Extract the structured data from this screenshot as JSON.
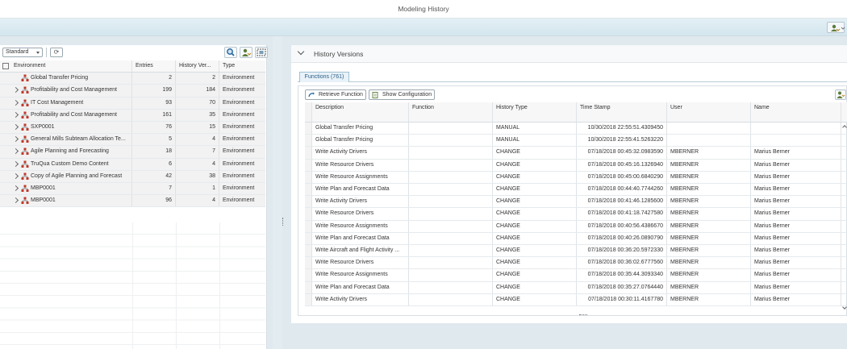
{
  "window": {
    "title": "Modeling History"
  },
  "left_panel": {
    "variant": "Standard",
    "columns": {
      "environment": "Environment",
      "entries": "Entries",
      "history_versions": "History Ver...",
      "type": "Type"
    },
    "rows": [
      {
        "environment": "Global Transfer Pricing",
        "entries": "2",
        "history_versions": "2",
        "type": "Environment",
        "expandable": false
      },
      {
        "environment": "Profitability and Cost Management",
        "entries": "199",
        "history_versions": "184",
        "type": "Environment",
        "expandable": true
      },
      {
        "environment": "IT Cost Management",
        "entries": "93",
        "history_versions": "70",
        "type": "Environment",
        "expandable": true
      },
      {
        "environment": "Profitability and Cost Management",
        "entries": "161",
        "history_versions": "35",
        "type": "Environment",
        "expandable": true
      },
      {
        "environment": "SXP0001",
        "entries": "76",
        "history_versions": "15",
        "type": "Environment",
        "expandable": true
      },
      {
        "environment": "General Mills Subteam Allocation Te...",
        "entries": "5",
        "history_versions": "4",
        "type": "Environment",
        "expandable": true
      },
      {
        "environment": "Agile Planning and Forecasting",
        "entries": "18",
        "history_versions": "7",
        "type": "Environment",
        "expandable": true
      },
      {
        "environment": "TruQua Custom Demo Content",
        "entries": "6",
        "history_versions": "4",
        "type": "Environment",
        "expandable": true
      },
      {
        "environment": "Copy of Agile Planning and Forecast",
        "entries": "42",
        "history_versions": "38",
        "type": "Environment",
        "expandable": true
      },
      {
        "environment": "MBP0001",
        "entries": "7",
        "history_versions": "1",
        "type": "Environment",
        "expandable": true
      },
      {
        "environment": "MBP0001",
        "entries": "96",
        "history_versions": "4",
        "type": "Environment",
        "expandable": true
      }
    ]
  },
  "right_panel": {
    "section_title": "History Versions",
    "tab_label": "Functions (761)",
    "toolbar": {
      "retrieve_label": "Retrieve Function",
      "show_config_label": "Show Configuration"
    },
    "columns": {
      "description": "Description",
      "function": "Function",
      "history_type": "History Type",
      "time_stamp": "Time Stamp",
      "user": "User",
      "name": "Name"
    },
    "rows": [
      {
        "description": "Global Transfer Pricing",
        "function": "",
        "history_type": "MANUAL",
        "time_stamp": "10/30/2018 22:55:51.4309450",
        "user": "",
        "name": ""
      },
      {
        "description": "Global Transfer Pricing",
        "function": "",
        "history_type": "MANUAL",
        "time_stamp": "10/30/2018 22:55:41.5263220",
        "user": "",
        "name": ""
      },
      {
        "description": "Write Activity Drivers",
        "function": "",
        "history_type": "CHANGE",
        "time_stamp": "07/18/2018 00:45:32.0983590",
        "user": "MBERNER",
        "name": "Marius Berner"
      },
      {
        "description": "Write Resource Drivers",
        "function": "",
        "history_type": "CHANGE",
        "time_stamp": "07/18/2018 00:45:16.1326940",
        "user": "MBERNER",
        "name": "Marius Berner"
      },
      {
        "description": "Write Resource Assignments",
        "function": "",
        "history_type": "CHANGE",
        "time_stamp": "07/18/2018 00:45:00.6840290",
        "user": "MBERNER",
        "name": "Marius Berner"
      },
      {
        "description": "Write Plan and Forecast Data",
        "function": "",
        "history_type": "CHANGE",
        "time_stamp": "07/18/2018 00:44:40.7744260",
        "user": "MBERNER",
        "name": "Marius Berner"
      },
      {
        "description": "Write Activity Drivers",
        "function": "",
        "history_type": "CHANGE",
        "time_stamp": "07/18/2018 00:41:46.1285600",
        "user": "MBERNER",
        "name": "Marius Berner"
      },
      {
        "description": "Write Resource Drivers",
        "function": "",
        "history_type": "CHANGE",
        "time_stamp": "07/18/2018 00:41:18.7427580",
        "user": "MBERNER",
        "name": "Marius Berner"
      },
      {
        "description": "Write Resource Assignments",
        "function": "",
        "history_type": "CHANGE",
        "time_stamp": "07/18/2018 00:40:56.4386670",
        "user": "MBERNER",
        "name": "Marius Berner"
      },
      {
        "description": "Write Plan and Forecast Data",
        "function": "",
        "history_type": "CHANGE",
        "time_stamp": "07/18/2018 00:40:26.0890790",
        "user": "MBERNER",
        "name": "Marius Berner"
      },
      {
        "description": "Write Aircraft and Flight Activity ...",
        "function": "",
        "history_type": "CHANGE",
        "time_stamp": "07/18/2018 00:36:20.5972330",
        "user": "MBERNER",
        "name": "Marius Berner"
      },
      {
        "description": "Write Resource Drivers",
        "function": "",
        "history_type": "CHANGE",
        "time_stamp": "07/18/2018 00:36:02.6777560",
        "user": "MBERNER",
        "name": "Marius Berner"
      },
      {
        "description": "Write Resource Assignments",
        "function": "",
        "history_type": "CHANGE",
        "time_stamp": "07/18/2018 00:35:44.3093340",
        "user": "MBERNER",
        "name": "Marius Berner"
      },
      {
        "description": "Write Plan and Forecast Data",
        "function": "",
        "history_type": "CHANGE",
        "time_stamp": "07/18/2018 00:35:27.0764440",
        "user": "MBERNER",
        "name": "Marius Berner"
      },
      {
        "description": "Write Activity Drivers",
        "function": "",
        "history_type": "CHANGE",
        "time_stamp": "07/18/2018 00:30:11.4167780",
        "user": "MBERNER",
        "name": "Marius Berner"
      }
    ]
  },
  "icons": {
    "node": "environment-node-icon",
    "search": "search-icon",
    "user_settings": "user-settings-icon",
    "select_all": "select-all-icon",
    "refresh": "refresh-icon",
    "retrieve": "retrieve-icon",
    "show_config": "document-icon"
  },
  "colors": {
    "accent": "#2b5c86",
    "node_icon": "#c0392b",
    "toolbar_bg": "#dfe9ee"
  }
}
